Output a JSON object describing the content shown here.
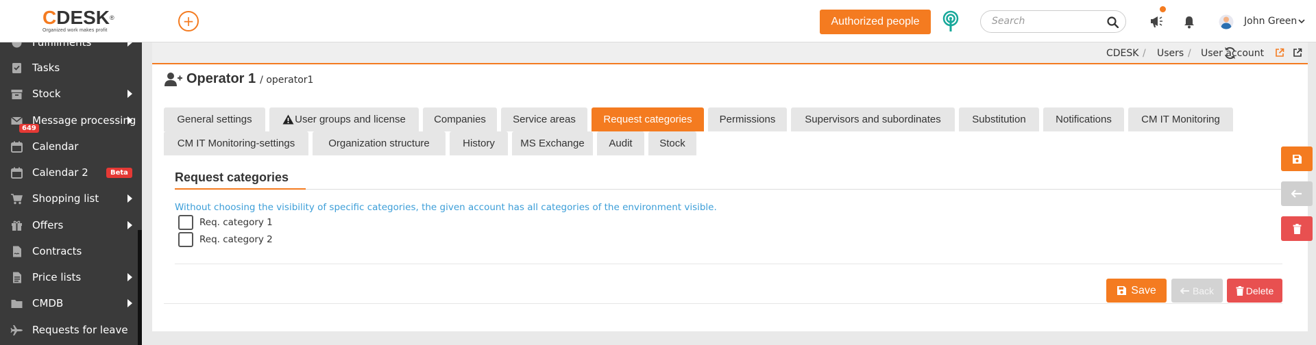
{
  "header": {
    "logo_text": "DESK",
    "logo_c": "C",
    "logo_reg": "®",
    "logo_tagline": "Organized work makes profit",
    "add_label": "+",
    "authorized_label": "Authorized people",
    "search_placeholder": "Search",
    "user_name": "John Green"
  },
  "sidebar": {
    "items": [
      {
        "label": "Fulfillments",
        "icon": "fulfillment-icon",
        "arrow": true
      },
      {
        "label": "Tasks",
        "icon": "tasks-icon",
        "arrow": false
      },
      {
        "label": "Stock",
        "icon": "archive-icon",
        "arrow": true
      },
      {
        "label": "Message processing",
        "icon": "envelope-icon",
        "arrow": true,
        "badge": "649"
      },
      {
        "label": "Calendar",
        "icon": "calendar-icon",
        "arrow": false
      },
      {
        "label": "Calendar 2",
        "icon": "calendar-icon",
        "arrow": false,
        "beta": "Beta"
      },
      {
        "label": "Shopping list",
        "icon": "cart-icon",
        "arrow": true
      },
      {
        "label": "Offers",
        "icon": "gift-icon",
        "arrow": true
      },
      {
        "label": "Contracts",
        "icon": "contract-icon",
        "arrow": false
      },
      {
        "label": "Price lists",
        "icon": "document-icon",
        "arrow": true
      },
      {
        "label": "CMDB",
        "icon": "folder-icon",
        "arrow": true
      },
      {
        "label": "Requests for leave",
        "icon": "plane-icon",
        "arrow": false
      }
    ]
  },
  "breadcrumb": {
    "items": [
      "CDESK",
      "Users",
      "User account"
    ],
    "sep": "/"
  },
  "page": {
    "title": "Operator 1",
    "subtitle": "/ operator1"
  },
  "tabs": [
    {
      "label": "General settings"
    },
    {
      "label": "User groups and license",
      "warn": true
    },
    {
      "label": "Companies"
    },
    {
      "label": "Service areas"
    },
    {
      "label": "Request categories",
      "active": true
    },
    {
      "label": "Permissions"
    },
    {
      "label": "Supervisors and subordinates"
    },
    {
      "label": "Substitution"
    },
    {
      "label": "Notifications"
    },
    {
      "label": "CM IT Monitoring"
    },
    {
      "label": "CM IT Monitoring-settings"
    },
    {
      "label": "Organization structure"
    },
    {
      "label": "History"
    },
    {
      "label": "MS Exchange"
    },
    {
      "label": "Audit"
    },
    {
      "label": "Stock"
    }
  ],
  "section": {
    "title": "Request categories",
    "info": "Without choosing the visibility of specific categories, the given account has all categories of the environment visible.",
    "categories": [
      {
        "label": "Req. category 1",
        "checked": false
      },
      {
        "label": "Req. category 2",
        "checked": false
      }
    ]
  },
  "actions": {
    "save": "Save",
    "back": "Back",
    "delete": "Delete"
  },
  "colors": {
    "accent": "#f47b20",
    "sidebar_bg": "#3a3a3a",
    "info_text": "#3c9ed8",
    "danger": "#e85050"
  }
}
